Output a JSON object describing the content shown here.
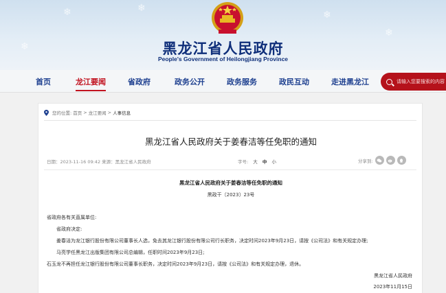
{
  "header": {
    "site_title": "黑龙江省人民政府",
    "site_subtitle": "People's Government of Heilongjiang Province"
  },
  "nav": {
    "items": [
      {
        "label": "首页",
        "active": false
      },
      {
        "label": "龙江要闻",
        "active": true
      },
      {
        "label": "省政府",
        "active": false
      },
      {
        "label": "政务公开",
        "active": false
      },
      {
        "label": "政务服务",
        "active": false
      },
      {
        "label": "政民互动",
        "active": false
      },
      {
        "label": "走进黑龙江",
        "active": false
      }
    ],
    "search_placeholder": "请输入您要搜索的内容"
  },
  "breadcrumb": {
    "prefix": "您的位置:",
    "items": [
      "首页",
      "龙江要闻",
      "人事信息"
    ],
    "separator": ">"
  },
  "article": {
    "title": "黑龙江省人民政府关于姜春洁等任免职的通知",
    "meta": "日期：2023-11-16 09:42  来源：黑龙江省人民政府",
    "font_size_label": "字号:",
    "font_sizes": [
      "大",
      "中",
      "小"
    ],
    "share_label": "分享到:",
    "share_icons": [
      "wechat-icon",
      "weibo-icon",
      "qq-icon"
    ],
    "doc_title": "黑龙江省人民政府关于姜春洁等任免职的通知",
    "doc_number": "黑政干〔2023〕23号",
    "recipients": "省政府各有关直属单位:",
    "decision_intro": "省政府决定:",
    "paragraphs": [
      "姜春洁为龙江银行股份有限公司董事长人选，免去其龙江银行股份有限公司行长职务，决定时间2023年9月23日，请按《公司法》和有关规定办理;",
      "马亮学任黑龙江出版集团有限公司总编辑，任职时间2023年9月23日;",
      "石玉龙不再担任龙江银行股份有限公司董事长职务，决定时间2023年9月23日，请按《公司法》和有关规定办理，退休。"
    ],
    "signer": "黑龙江省人民政府",
    "date": "2023年11月15日"
  },
  "colors": {
    "brand_blue": "#1d3f8f",
    "brand_red": "#c1121f"
  }
}
